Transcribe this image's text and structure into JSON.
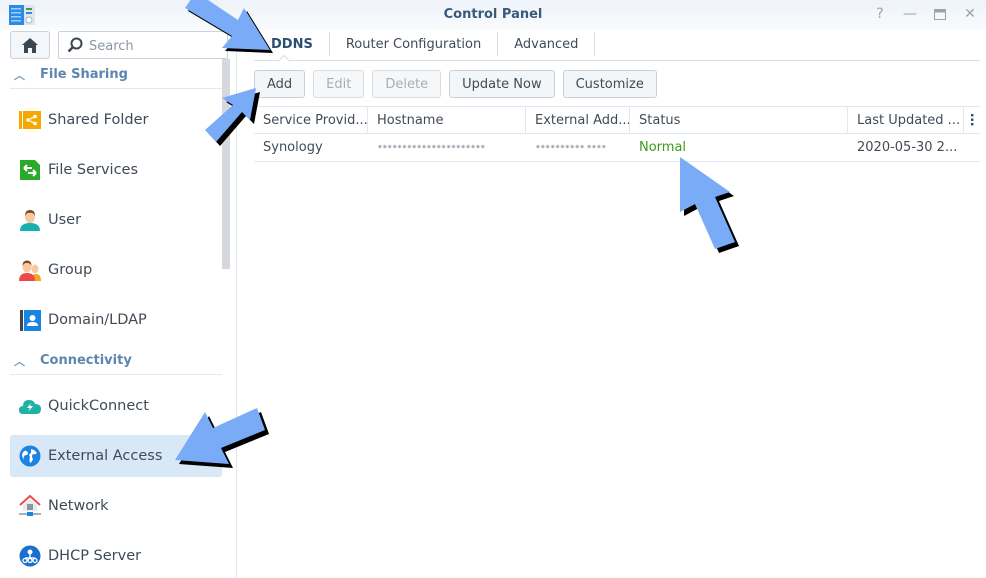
{
  "window": {
    "title": "Control Panel",
    "controls": {
      "help": "?",
      "minimize": "—",
      "maximize": "▭",
      "close": "✕"
    }
  },
  "sidebar": {
    "search_placeholder": "Search",
    "sections": [
      {
        "label": "File Sharing",
        "items": [
          {
            "label": "Shared Folder",
            "icon": "shared-folder-icon"
          },
          {
            "label": "File Services",
            "icon": "file-services-icon"
          },
          {
            "label": "User",
            "icon": "user-icon"
          },
          {
            "label": "Group",
            "icon": "group-icon"
          },
          {
            "label": "Domain/LDAP",
            "icon": "domain-ldap-icon"
          }
        ]
      },
      {
        "label": "Connectivity",
        "items": [
          {
            "label": "QuickConnect",
            "icon": "quickconnect-icon"
          },
          {
            "label": "External Access",
            "icon": "external-access-icon",
            "active": true
          },
          {
            "label": "Network",
            "icon": "network-icon"
          },
          {
            "label": "DHCP Server",
            "icon": "dhcp-server-icon"
          }
        ]
      }
    ]
  },
  "main": {
    "tabs": [
      {
        "label": "DDNS",
        "active": true
      },
      {
        "label": "Router Configuration"
      },
      {
        "label": "Advanced"
      }
    ],
    "toolbar": {
      "add": "Add",
      "edit": "Edit",
      "delete": "Delete",
      "update_now": "Update Now",
      "customize": "Customize"
    },
    "table": {
      "columns": [
        "Service Provid...",
        "Hostname",
        "External Add...",
        "Status",
        "Last Updated ..."
      ],
      "rows": [
        {
          "service_provider": "Synology",
          "hostname": "••••••••••••••••••••••",
          "external_address": "•••••••••• ••••",
          "status": "Normal",
          "last_updated": "2020-05-30 2..."
        }
      ]
    }
  },
  "colors": {
    "accent": "#2b4e73",
    "status_normal": "#3f9a1c",
    "active_nav": "#d9e8f7",
    "arrow": "#7aabf7"
  }
}
